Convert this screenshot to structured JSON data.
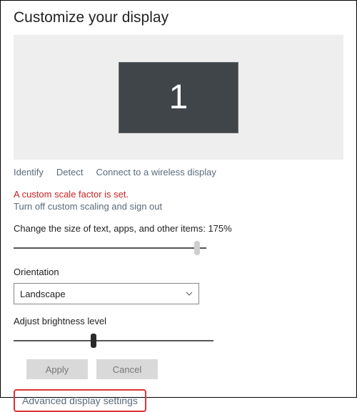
{
  "title": "Customize your display",
  "monitor": {
    "number": "1"
  },
  "links": {
    "identify": "Identify",
    "detect": "Detect",
    "wireless": "Connect to a wireless display"
  },
  "scale_warning": "A custom scale factor is set.",
  "turn_off_scaling": "Turn off custom scaling and sign out",
  "scale_label_prefix": "Change the size of text, apps, and other items: ",
  "scale_value": "175%",
  "scale_slider_percent": 95,
  "orientation": {
    "label": "Orientation",
    "value": "Landscape"
  },
  "brightness": {
    "label": "Adjust brightness level",
    "slider_percent": 40
  },
  "buttons": {
    "apply": "Apply",
    "cancel": "Cancel"
  },
  "advanced": "Advanced display settings"
}
